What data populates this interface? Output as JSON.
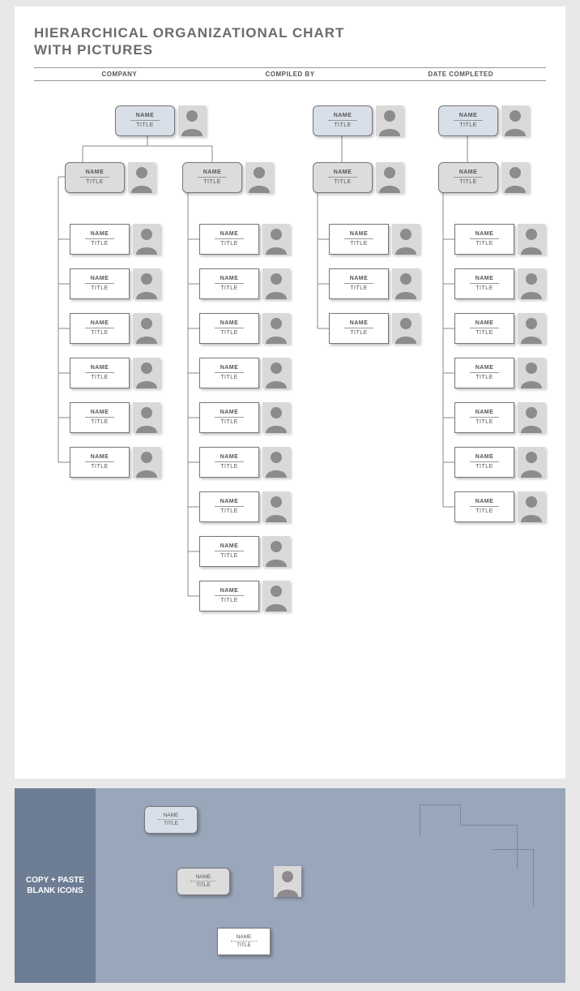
{
  "title_line1": "HIERARCHICAL ORGANIZATIONAL CHART",
  "title_line2": "WITH PICTURES",
  "headers": {
    "company": "COMPANY",
    "compiled_by": "COMPILED BY",
    "date_completed": "DATE COMPLETED"
  },
  "node_label": {
    "name": "NAME",
    "title": "TITLE"
  },
  "helper_label_line1": "COPY + PASTE",
  "helper_label_line2": "BLANK ICONS",
  "chart_data": {
    "type": "hierarchy-tree",
    "title": "Hierarchical Organizational Chart with Pictures (template)",
    "template_headers": [
      "COMPANY",
      "COMPILED BY",
      "DATE COMPLETED"
    ],
    "legend": {
      "blue_rounded": "top-level",
      "gray_rounded": "second-level",
      "white_rect": "leaf"
    },
    "trees": [
      {
        "root": {
          "name": "NAME",
          "title": "TITLE",
          "style": "blue_rounded"
        },
        "children": [
          {
            "node": {
              "name": "NAME",
              "title": "TITLE",
              "style": "gray_rounded"
            },
            "children": [
              {
                "name": "NAME",
                "title": "TITLE",
                "style": "white_rect"
              },
              {
                "name": "NAME",
                "title": "TITLE",
                "style": "white_rect"
              },
              {
                "name": "NAME",
                "title": "TITLE",
                "style": "white_rect"
              },
              {
                "name": "NAME",
                "title": "TITLE",
                "style": "white_rect"
              },
              {
                "name": "NAME",
                "title": "TITLE",
                "style": "white_rect"
              },
              {
                "name": "NAME",
                "title": "TITLE",
                "style": "white_rect"
              }
            ]
          },
          {
            "node": {
              "name": "NAME",
              "title": "TITLE",
              "style": "gray_rounded"
            },
            "children": [
              {
                "name": "NAME",
                "title": "TITLE",
                "style": "white_rect"
              },
              {
                "name": "NAME",
                "title": "TITLE",
                "style": "white_rect"
              },
              {
                "name": "NAME",
                "title": "TITLE",
                "style": "white_rect"
              },
              {
                "name": "NAME",
                "title": "TITLE",
                "style": "white_rect"
              },
              {
                "name": "NAME",
                "title": "TITLE",
                "style": "white_rect"
              },
              {
                "name": "NAME",
                "title": "TITLE",
                "style": "white_rect"
              },
              {
                "name": "NAME",
                "title": "TITLE",
                "style": "white_rect"
              },
              {
                "name": "NAME",
                "title": "TITLE",
                "style": "white_rect"
              },
              {
                "name": "NAME",
                "title": "TITLE",
                "style": "white_rect"
              }
            ]
          }
        ]
      },
      {
        "root": {
          "name": "NAME",
          "title": "TITLE",
          "style": "blue_rounded"
        },
        "children": [
          {
            "node": {
              "name": "NAME",
              "title": "TITLE",
              "style": "gray_rounded"
            },
            "children": [
              {
                "name": "NAME",
                "title": "TITLE",
                "style": "white_rect"
              },
              {
                "name": "NAME",
                "title": "TITLE",
                "style": "white_rect"
              },
              {
                "name": "NAME",
                "title": "TITLE",
                "style": "white_rect"
              }
            ]
          }
        ]
      },
      {
        "root": {
          "name": "NAME",
          "title": "TITLE",
          "style": "blue_rounded"
        },
        "children": [
          {
            "node": {
              "name": "NAME",
              "title": "TITLE",
              "style": "gray_rounded"
            },
            "children": [
              {
                "name": "NAME",
                "title": "TITLE",
                "style": "white_rect"
              },
              {
                "name": "NAME",
                "title": "TITLE",
                "style": "white_rect"
              },
              {
                "name": "NAME",
                "title": "TITLE",
                "style": "white_rect"
              },
              {
                "name": "NAME",
                "title": "TITLE",
                "style": "white_rect"
              },
              {
                "name": "NAME",
                "title": "TITLE",
                "style": "white_rect"
              },
              {
                "name": "NAME",
                "title": "TITLE",
                "style": "white_rect"
              },
              {
                "name": "NAME",
                "title": "TITLE",
                "style": "white_rect"
              }
            ]
          }
        ]
      }
    ],
    "palette_panel": {
      "label": "COPY + PASTE BLANK ICONS",
      "items": [
        "blue_rounded_box",
        "gray_rounded_box",
        "white_rect_box",
        "photo_placeholder",
        "connector_segments"
      ]
    }
  }
}
